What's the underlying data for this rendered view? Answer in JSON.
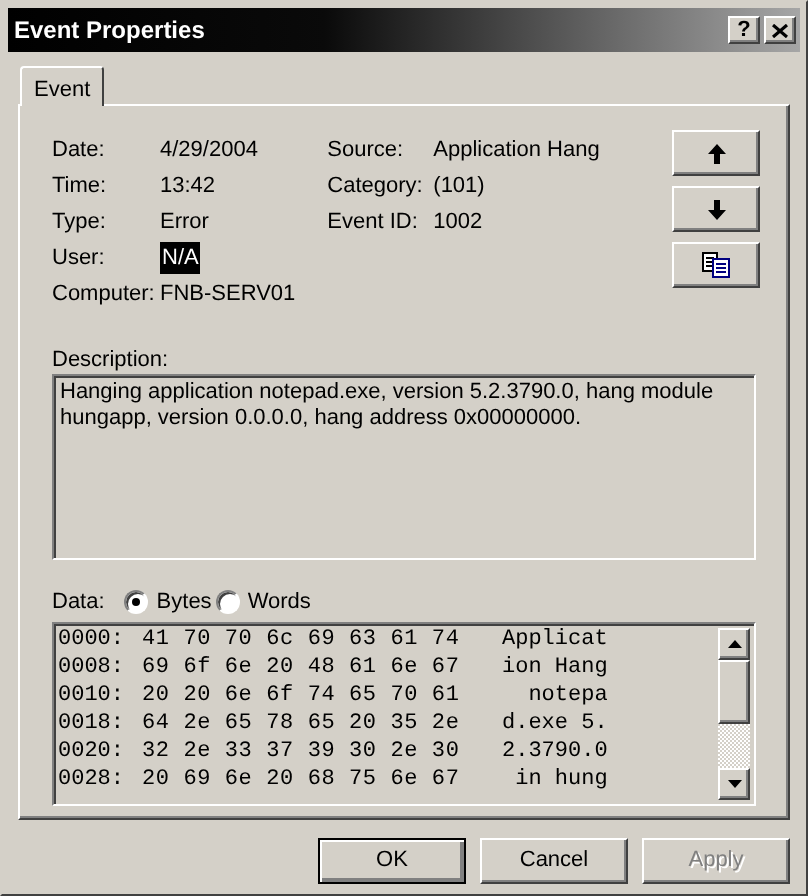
{
  "window": {
    "title": "Event Properties",
    "help_button": "?"
  },
  "tabs": [
    {
      "label": "Event",
      "selected": true
    }
  ],
  "fields_left": [
    {
      "label": "Date:",
      "value": "4/29/2004",
      "highlighted": false
    },
    {
      "label": "Time:",
      "value": "13:42",
      "highlighted": false
    },
    {
      "label": "Type:",
      "value": "Error",
      "highlighted": false
    },
    {
      "label": "User:",
      "value": "N/A",
      "highlighted": true
    },
    {
      "label": "Computer:",
      "value": "FNB-SERV01",
      "highlighted": false
    }
  ],
  "fields_right": [
    {
      "label": "Source:",
      "value": "Application Hang"
    },
    {
      "label": "Category:",
      "value": "(101)"
    },
    {
      "label": "Event ID:",
      "value": "1002"
    }
  ],
  "side_buttons": [
    {
      "kind": "up"
    },
    {
      "kind": "down"
    },
    {
      "kind": "copy"
    }
  ],
  "description": {
    "label": "Description:",
    "text": "Hanging application notepad.exe, version 5.2.3790.0, hang module hungapp, version 0.0.0.0, hang address 0x00000000."
  },
  "data": {
    "label": "Data:",
    "formats": [
      {
        "label": "Bytes",
        "selected": true
      },
      {
        "label": "Words",
        "selected": false
      }
    ],
    "rows": [
      {
        "offset": "0000:",
        "bytes": "41 70 70 6c 69 63 61 74",
        "text": "Applicat"
      },
      {
        "offset": "0008:",
        "bytes": "69 6f 6e 20 48 61 6e 67",
        "text": "ion Hang"
      },
      {
        "offset": "0010:",
        "bytes": "20 20 6e 6f 74 65 70 61",
        "text": "  notepa"
      },
      {
        "offset": "0018:",
        "bytes": "64 2e 65 78 65 20 35 2e",
        "text": "d.exe 5."
      },
      {
        "offset": "0020:",
        "bytes": "32 2e 33 37 39 30 2e 30",
        "text": "2.3790.0"
      },
      {
        "offset": "0028:",
        "bytes": "20 69 6e 20 68 75 6e 67",
        "text": " in hung"
      }
    ]
  },
  "buttons": [
    {
      "label": "OK",
      "default": true,
      "disabled": false
    },
    {
      "label": "Cancel",
      "default": false,
      "disabled": false
    },
    {
      "label": "Apply",
      "default": false,
      "disabled": true
    }
  ]
}
